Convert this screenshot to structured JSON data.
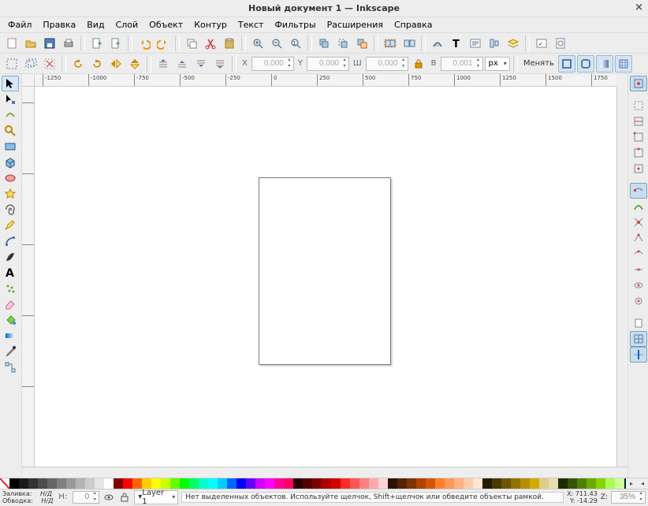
{
  "title": "Новый документ 1 — Inkscape",
  "menu": [
    "Файл",
    "Правка",
    "Вид",
    "Слой",
    "Объект",
    "Контур",
    "Текст",
    "Фильтры",
    "Расширения",
    "Справка"
  ],
  "toolbar2": {
    "x_label": "X",
    "y_label": "Y",
    "w_label": "Ш",
    "h_label": "В",
    "x": "0,000",
    "y": "0,000",
    "w": "0,000",
    "h": "0,001",
    "unit": "px",
    "menubtn": "Менять"
  },
  "ruler_h": [
    "-1250",
    "-1000",
    "-750",
    "-500",
    "-250",
    "0",
    "250",
    "500",
    "750",
    "1000",
    "1250",
    "1500",
    "1750"
  ],
  "ruler_v": [
    "0",
    "250",
    "500",
    "750",
    "1000",
    "500"
  ],
  "layer": "Layer 1",
  "status": {
    "fill_label": "Заливка:",
    "fill_val": "Н/Д",
    "stroke_label": "Обводка:",
    "stroke_val": "Н/Д",
    "opacity_label": "Н:",
    "opacity": "0",
    "msg": "Нет выделенных объектов. Используйте щелчок, Shift+щелчок или обведите объекты рамкой.",
    "x_label": "X:",
    "x": "711.43",
    "y_label": "Y:",
    "y": "-14.29",
    "z_label": "Z:",
    "zoom": "35%"
  },
  "palette": [
    "#000000",
    "#1a1a1a",
    "#333333",
    "#4d4d4d",
    "#666666",
    "#808080",
    "#999999",
    "#b3b3b3",
    "#cccccc",
    "#e6e6e6",
    "#ffffff",
    "#800000",
    "#ff0000",
    "#ff6600",
    "#ffcc00",
    "#ffff00",
    "#ccff00",
    "#66ff00",
    "#00ff00",
    "#00ff66",
    "#00ffcc",
    "#00ffff",
    "#00ccff",
    "#0066ff",
    "#0000ff",
    "#6600ff",
    "#cc00ff",
    "#ff00ff",
    "#ff0099",
    "#ff0066",
    "#2b0000",
    "#550000",
    "#800000",
    "#aa0000",
    "#d40000",
    "#ff2a2a",
    "#ff5555",
    "#ff8080",
    "#ffaaaa",
    "#ffd5d5",
    "#2b1100",
    "#552200",
    "#803300",
    "#aa4400",
    "#d45500",
    "#ff7f2a",
    "#ff9955",
    "#ffb380",
    "#ffccaa",
    "#ffe6d5",
    "#241c00",
    "#493900",
    "#6c5600",
    "#917200",
    "#b58f00",
    "#d4aa00",
    "#decd87",
    "#e9ddaf",
    "#1b2b00",
    "#365500",
    "#508000",
    "#6baa00",
    "#86d400",
    "#aaff55",
    "#ccff99",
    "#002b11",
    "#005522",
    "#008033",
    "#00aa44",
    "#00d455",
    "#55ff99",
    "#00112b",
    "#002255",
    "#003380",
    "#0044aa",
    "#0066d4"
  ]
}
